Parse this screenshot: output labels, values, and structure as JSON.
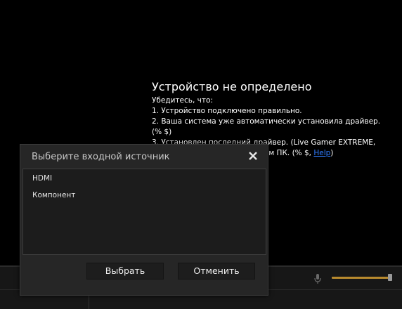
{
  "background_message": {
    "title": "Устройство не определено",
    "lines": [
      "Убедитесь, что:",
      "1. Устройство подключено правильно.",
      "2. Ваша система уже автоматически установила драйвер.",
      "(% $)",
      "3. Установлен последний драйвер. (Live Gamer EXTREME,",
      "жим ПК. (% $, "
    ],
    "help_link": "Help",
    "after_link": ")"
  },
  "dialog": {
    "title": "Выберите входной источник",
    "close_icon": "close-icon",
    "sources": [
      "HDMI",
      "Компонент"
    ],
    "select_label": "Выбрать",
    "cancel_label": "Отменить"
  },
  "bottom_bar": {
    "mic_icon": "microphone-icon",
    "volume_level": 0.96,
    "colors": {
      "volume_track": "#b88a2e"
    }
  }
}
